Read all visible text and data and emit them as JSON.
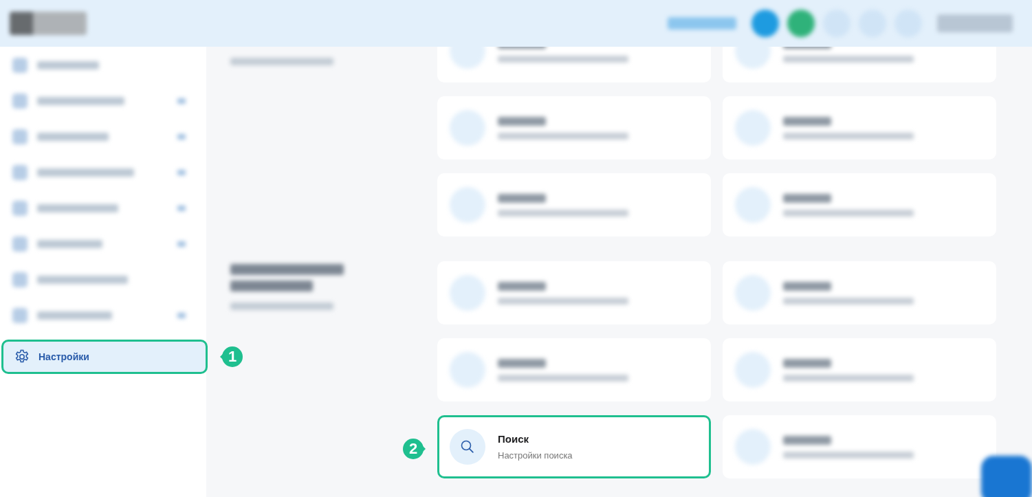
{
  "sidebar": {
    "active_item": {
      "label": "Настройки",
      "selected": true
    },
    "callout": "1"
  },
  "cards": {
    "highlighted_card": {
      "title": "Поиск",
      "subtitle": "Настройки поиска",
      "selected": true
    },
    "callout": "2"
  }
}
